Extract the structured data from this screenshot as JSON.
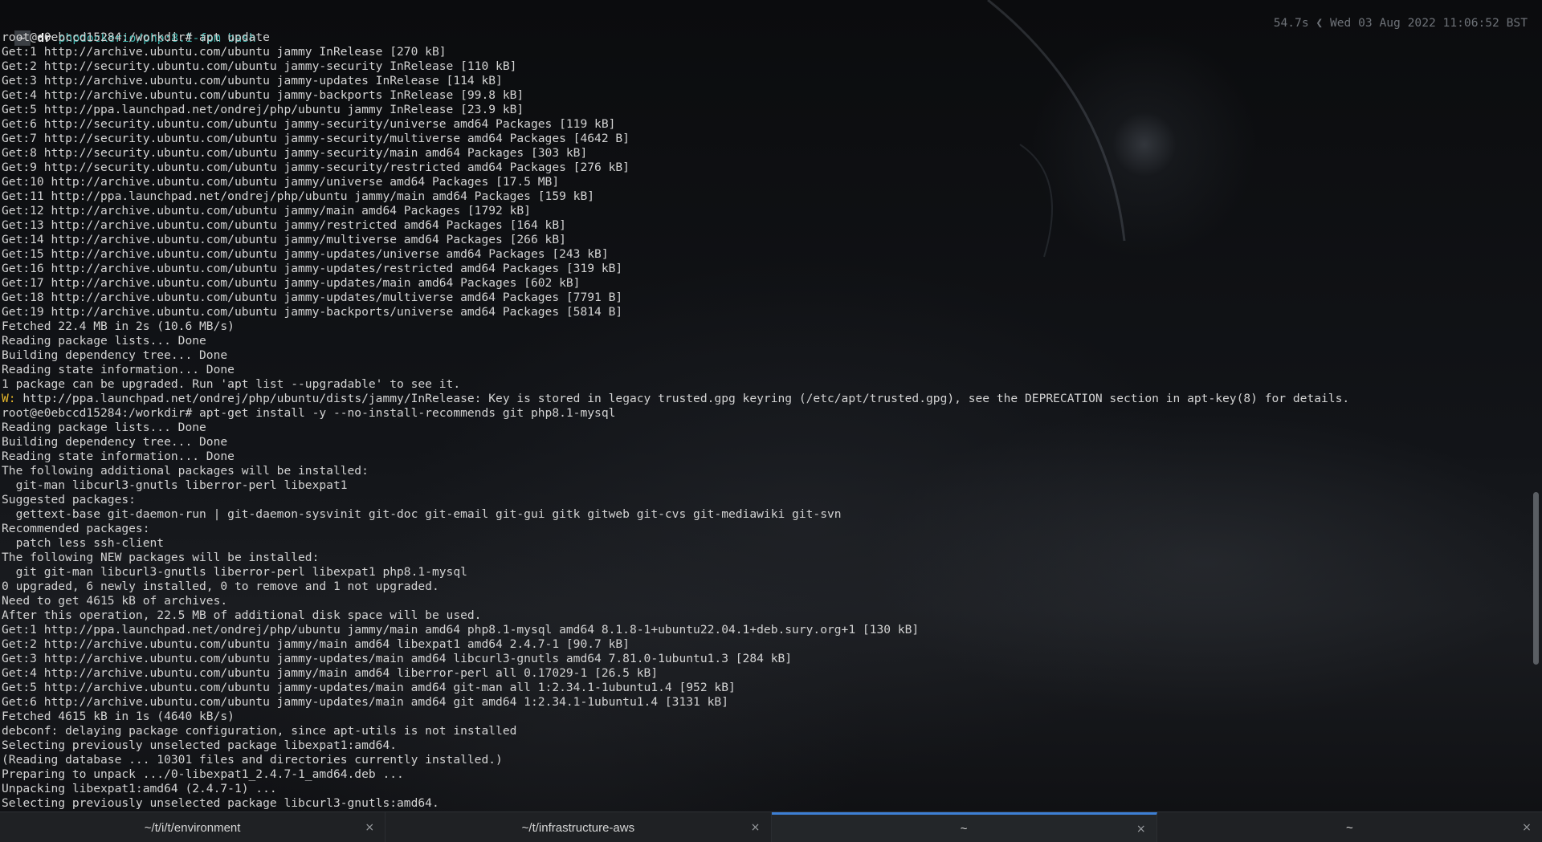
{
  "prompt": {
    "tilde": "~",
    "command": "dr",
    "argument": "phpdockerio/php:8.1-fpm bash"
  },
  "status": {
    "text": "54.7s ❮ Wed 03 Aug 2022 11:06:52 BST"
  },
  "terminal": {
    "lines": [
      "root@e0ebccd15284:/workdir# apt update",
      "Get:1 http://archive.ubuntu.com/ubuntu jammy InRelease [270 kB]",
      "Get:2 http://security.ubuntu.com/ubuntu jammy-security InRelease [110 kB]",
      "Get:3 http://archive.ubuntu.com/ubuntu jammy-updates InRelease [114 kB]",
      "Get:4 http://archive.ubuntu.com/ubuntu jammy-backports InRelease [99.8 kB]",
      "Get:5 http://ppa.launchpad.net/ondrej/php/ubuntu jammy InRelease [23.9 kB]",
      "Get:6 http://security.ubuntu.com/ubuntu jammy-security/universe amd64 Packages [119 kB]",
      "Get:7 http://security.ubuntu.com/ubuntu jammy-security/multiverse amd64 Packages [4642 B]",
      "Get:8 http://security.ubuntu.com/ubuntu jammy-security/main amd64 Packages [303 kB]",
      "Get:9 http://security.ubuntu.com/ubuntu jammy-security/restricted amd64 Packages [276 kB]",
      "Get:10 http://archive.ubuntu.com/ubuntu jammy/universe amd64 Packages [17.5 MB]",
      "Get:11 http://ppa.launchpad.net/ondrej/php/ubuntu jammy/main amd64 Packages [159 kB]",
      "Get:12 http://archive.ubuntu.com/ubuntu jammy/main amd64 Packages [1792 kB]",
      "Get:13 http://archive.ubuntu.com/ubuntu jammy/restricted amd64 Packages [164 kB]",
      "Get:14 http://archive.ubuntu.com/ubuntu jammy/multiverse amd64 Packages [266 kB]",
      "Get:15 http://archive.ubuntu.com/ubuntu jammy-updates/universe amd64 Packages [243 kB]",
      "Get:16 http://archive.ubuntu.com/ubuntu jammy-updates/restricted amd64 Packages [319 kB]",
      "Get:17 http://archive.ubuntu.com/ubuntu jammy-updates/main amd64 Packages [602 kB]",
      "Get:18 http://archive.ubuntu.com/ubuntu jammy-updates/multiverse amd64 Packages [7791 B]",
      "Get:19 http://archive.ubuntu.com/ubuntu jammy-backports/universe amd64 Packages [5814 B]",
      "Fetched 22.4 MB in 2s (10.6 MB/s)",
      "Reading package lists... Done",
      "Building dependency tree... Done",
      "Reading state information... Done",
      "1 package can be upgraded. Run 'apt list --upgradable' to see it.",
      "",
      "root@e0ebccd15284:/workdir# apt-get install -y --no-install-recommends git php8.1-mysql",
      "Reading package lists... Done",
      "Building dependency tree... Done",
      "Reading state information... Done",
      "The following additional packages will be installed:",
      "  git-man libcurl3-gnutls liberror-perl libexpat1",
      "Suggested packages:",
      "  gettext-base git-daemon-run | git-daemon-sysvinit git-doc git-email git-gui gitk gitweb git-cvs git-mediawiki git-svn",
      "Recommended packages:",
      "  patch less ssh-client",
      "The following NEW packages will be installed:",
      "  git git-man libcurl3-gnutls liberror-perl libexpat1 php8.1-mysql",
      "0 upgraded, 6 newly installed, 0 to remove and 1 not upgraded.",
      "Need to get 4615 kB of archives.",
      "After this operation, 22.5 MB of additional disk space will be used.",
      "Get:1 http://ppa.launchpad.net/ondrej/php/ubuntu jammy/main amd64 php8.1-mysql amd64 8.1.8-1+ubuntu22.04.1+deb.sury.org+1 [130 kB]",
      "Get:2 http://archive.ubuntu.com/ubuntu jammy/main amd64 libexpat1 amd64 2.4.7-1 [90.7 kB]",
      "Get:3 http://archive.ubuntu.com/ubuntu jammy-updates/main amd64 libcurl3-gnutls amd64 7.81.0-1ubuntu1.3 [284 kB]",
      "Get:4 http://archive.ubuntu.com/ubuntu jammy/main amd64 liberror-perl all 0.17029-1 [26.5 kB]",
      "Get:5 http://archive.ubuntu.com/ubuntu jammy-updates/main amd64 git-man all 1:2.34.1-1ubuntu1.4 [952 kB]",
      "Get:6 http://archive.ubuntu.com/ubuntu jammy-updates/main amd64 git amd64 1:2.34.1-1ubuntu1.4 [3131 kB]",
      "Fetched 4615 kB in 1s (4640 kB/s)",
      "debconf: delaying package configuration, since apt-utils is not installed",
      "Selecting previously unselected package libexpat1:amd64.",
      "(Reading database ... 10301 files and directories currently installed.)",
      "Preparing to unpack .../0-libexpat1_2.4.7-1_amd64.deb ...",
      "Unpacking libexpat1:amd64 (2.4.7-1) ...",
      "Selecting previously unselected package libcurl3-gnutls:amd64."
    ],
    "warning": {
      "tag": "W:",
      "text": " http://ppa.launchpad.net/ondrej/php/ubuntu/dists/jammy/InRelease: Key is stored in legacy trusted.gpg keyring (/etc/apt/trusted.gpg), see the DEPRECATION section in apt-key(8) for details."
    }
  },
  "tabs": [
    {
      "label": "~/t/i/t/environment",
      "close": "×"
    },
    {
      "label": "~/t/infrastructure-aws",
      "close": "×"
    },
    {
      "label": "~",
      "close": "×"
    },
    {
      "label": "~",
      "close": "×"
    }
  ]
}
